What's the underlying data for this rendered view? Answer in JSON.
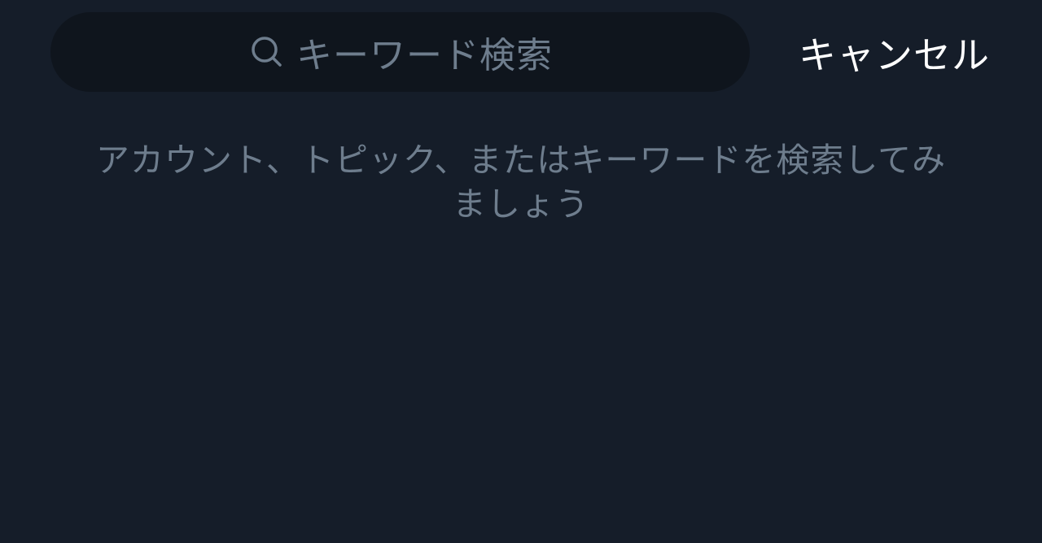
{
  "search": {
    "placeholder": "キーワード検索",
    "icon": "search-icon"
  },
  "header": {
    "cancel_label": "キャンセル"
  },
  "empty_state": {
    "line1": "アカウント、トピック、またはキーワードを検索してみ",
    "line2": "ましょう"
  },
  "colors": {
    "background": "#151d29",
    "search_field": "#0f151d",
    "muted_text": "#6e7d8d",
    "primary_text": "#ffffff"
  }
}
